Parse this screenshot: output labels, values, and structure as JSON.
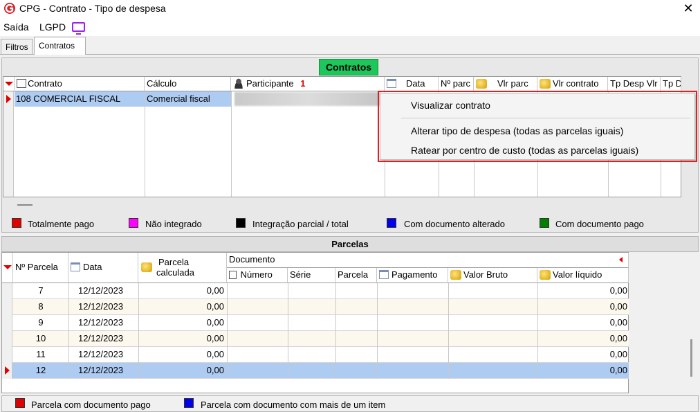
{
  "window": {
    "title": "CPG - Contrato - Tipo de despesa",
    "close_glyph": "✕"
  },
  "menu": {
    "saida": "Saída",
    "lgpd": "LGPD"
  },
  "tabs": [
    {
      "label": "Filtros"
    },
    {
      "label": "Contratos"
    }
  ],
  "contratos": {
    "title": "Contratos",
    "columns": [
      "Contrato",
      "Cálculo",
      "Participante",
      "1",
      "Data",
      "Nº parc",
      "Vlr parc",
      "Vlr contrato",
      "Tp Desp Vlr",
      "Tp D"
    ],
    "rows": [
      {
        "contrato": "108 COMERCIAL FISCAL",
        "calculo": "Comercial fiscal"
      }
    ]
  },
  "context_menu": {
    "items": [
      "Visualizar contrato",
      "Alterar tipo de despesa (todas as parcelas iguais)",
      "Ratear por centro de custo (todas as parcelas iguais)"
    ]
  },
  "legend_contratos": [
    {
      "label": "Totalmente pago",
      "color": "#e00000"
    },
    {
      "label": "Não integrado",
      "color": "#ff00ff"
    },
    {
      "label": "Integração parcial / total",
      "color": "#000000"
    },
    {
      "label": "Com documento alterado",
      "color": "#0000ee"
    },
    {
      "label": "Com documento pago",
      "color": "#008000"
    }
  ],
  "parcelas": {
    "title": "Parcelas",
    "columns": {
      "num_parcela": "Nº Parcela",
      "data": "Data",
      "parcela_calc_1": "Parcela",
      "parcela_calc_2": "calculada",
      "documento": "Documento",
      "numero": "Número",
      "serie": "Série",
      "parcela": "Parcela",
      "pagamento": "Pagamento",
      "valor_bruto": "Valor Bruto",
      "valor_liquido": "Valor líquido"
    },
    "rows": [
      {
        "num": "7",
        "data": "12/12/2023",
        "calc": "0,00",
        "liquido": "0,00"
      },
      {
        "num": "8",
        "data": "12/12/2023",
        "calc": "0,00",
        "liquido": "0,00"
      },
      {
        "num": "9",
        "data": "12/12/2023",
        "calc": "0,00",
        "liquido": "0,00"
      },
      {
        "num": "10",
        "data": "12/12/2023",
        "calc": "0,00",
        "liquido": "0,00"
      },
      {
        "num": "11",
        "data": "12/12/2023",
        "calc": "0,00",
        "liquido": "0,00"
      },
      {
        "num": "12",
        "data": "12/12/2023",
        "calc": "0,00",
        "liquido": "0,00"
      }
    ]
  },
  "legend_parcelas": [
    {
      "label": "Parcela com documento pago",
      "color": "#e00000"
    },
    {
      "label": "Parcela com documento com mais de um item",
      "color": "#0000ee"
    }
  ]
}
